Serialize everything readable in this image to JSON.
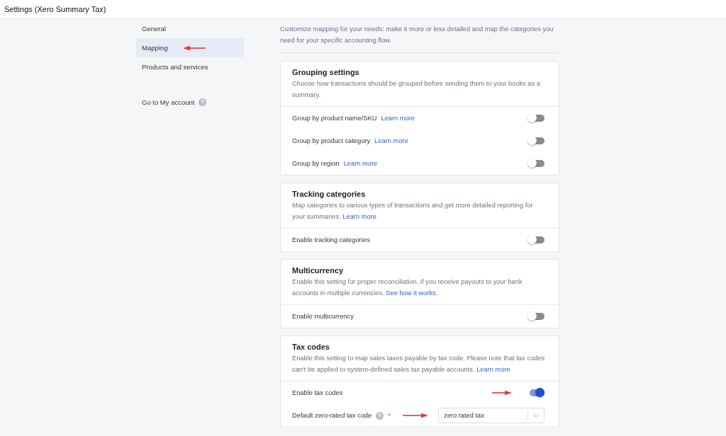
{
  "window": {
    "title": "Settings (Xero Summary Tax)"
  },
  "sidebar": {
    "items": [
      {
        "label": "General",
        "selected": false,
        "annotated": false
      },
      {
        "label": "Mapping",
        "selected": true,
        "annotated": true
      },
      {
        "label": "Products and services",
        "selected": false,
        "annotated": false
      }
    ],
    "account_link": {
      "label": "Go to My account"
    }
  },
  "intro": {
    "description": "Customize mapping for your needs: make it more or less detailed and map the categories you need for your specific accounting flow."
  },
  "sections": [
    {
      "title": "Grouping settings",
      "description": "Choose how transactions should be grouped before sending them to your books as a summary.",
      "rows": [
        {
          "kind": "toggle",
          "label": "Group by product name/SKU",
          "link": "Learn more",
          "on": false,
          "annotated": false
        },
        {
          "kind": "toggle",
          "label": "Group by product category",
          "link": "Learn more",
          "on": false,
          "annotated": false
        },
        {
          "kind": "toggle",
          "label": "Group by region",
          "link": "Learn more",
          "on": false,
          "annotated": false
        }
      ]
    },
    {
      "title": "Tracking categories",
      "description": "Map categories to various types of transactions and get more detailed reporting for your summaries.",
      "description_link": "Learn more",
      "rows": [
        {
          "kind": "toggle",
          "label": "Enable tracking categories",
          "on": false,
          "annotated": false
        }
      ]
    },
    {
      "title": "Multicurrency",
      "description": "Enable this setting for proper reconciliation, if you receive payouts to your bank accounts in multiple currencies.",
      "description_link": "See how it works",
      "description_end": ".",
      "rows": [
        {
          "kind": "toggle",
          "label": "Enable multicurrency",
          "on": false,
          "annotated": false
        }
      ]
    },
    {
      "title": "Tax codes",
      "description": "Enable this setting to map sales taxes payable by tax code. Please note that tax codes can't be applied to system-defined sales tax payable accounts.",
      "description_link": "Learn more",
      "rows": [
        {
          "kind": "toggle",
          "label": "Enable tax codes",
          "on": true,
          "annotated": true
        },
        {
          "kind": "select",
          "label": "Default zero-rated tax code",
          "required": "*",
          "value": "zero rated tax",
          "annotated": true
        }
      ]
    }
  ]
}
